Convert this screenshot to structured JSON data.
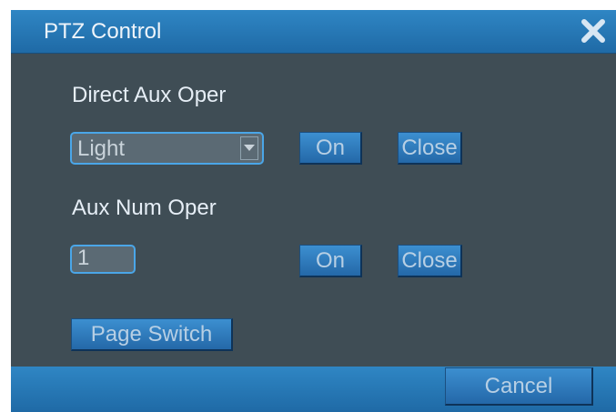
{
  "dialog": {
    "title": "PTZ Control",
    "close_icon": "close-x-icon"
  },
  "direct_aux": {
    "label": "Direct Aux Oper",
    "select_value": "Light",
    "on_label": "On",
    "close_label": "Close"
  },
  "aux_num": {
    "label": "Aux Num Oper",
    "input_value": "1",
    "on_label": "On",
    "close_label": "Close"
  },
  "page_switch_label": "Page Switch",
  "footer": {
    "cancel_label": "Cancel"
  },
  "colors": {
    "titlebar": "#2a7bbd",
    "body": "#3f4d55",
    "button": "#2f7cc0",
    "focus_border": "#4aa6e8"
  }
}
